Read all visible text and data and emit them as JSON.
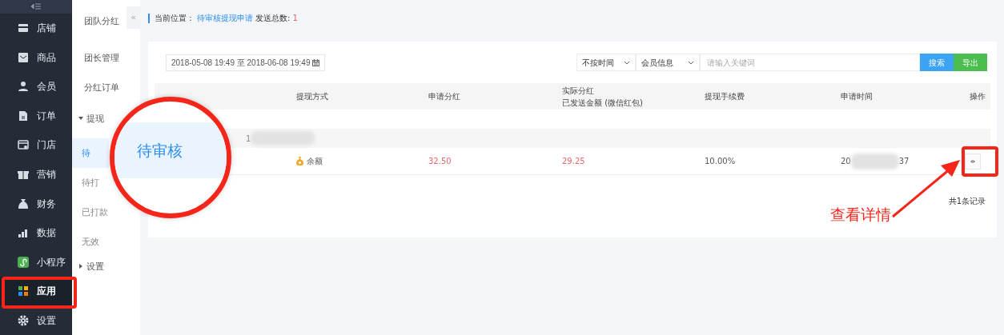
{
  "sidebar": {
    "items": [
      {
        "label": "店铺",
        "selected": false
      },
      {
        "label": "商品",
        "selected": false
      },
      {
        "label": "会员",
        "selected": false
      },
      {
        "label": "订单",
        "selected": false
      },
      {
        "label": "门店",
        "selected": false
      },
      {
        "label": "营销",
        "selected": false
      },
      {
        "label": "财务",
        "selected": false
      },
      {
        "label": "数据",
        "selected": false
      },
      {
        "label": "小程序",
        "selected": false
      },
      {
        "label": "应用",
        "selected": true
      },
      {
        "label": "设置",
        "selected": false
      }
    ]
  },
  "subnav": {
    "collapse_glyph": "«",
    "items": [
      {
        "label": "团队分红",
        "kind": "title"
      },
      {
        "label": "团长管理",
        "kind": "link"
      },
      {
        "label": "分红订单",
        "kind": "link"
      },
      {
        "label": "提现",
        "kind": "group",
        "expanded": true,
        "children": [
          {
            "label": "待",
            "selected": true
          },
          {
            "label": "待打",
            "selected": false
          },
          {
            "label": "已打款",
            "selected": false
          },
          {
            "label": "无效",
            "selected": false
          }
        ]
      },
      {
        "label": "设置",
        "kind": "group",
        "expanded": false
      }
    ]
  },
  "breadcrumb": {
    "label": "当前位置：",
    "page": "待审核提现申请",
    "count_label": "发送总数:",
    "count": "1"
  },
  "filters": {
    "date_range": "2018-05-08 19:49 至 2018-06-08 19:49",
    "selects": [
      "不按时间",
      "会员信息"
    ],
    "search": {
      "placeholder": "请输入关键词"
    },
    "buttons": [
      {
        "label": "搜索",
        "kind": "primary"
      },
      {
        "label": "导出",
        "kind": "success"
      }
    ]
  },
  "table": {
    "columns": [
      {
        "lines": [
          "提现方式"
        ]
      },
      {
        "lines": [
          "申请分红"
        ]
      },
      {
        "lines": [
          "实际分红",
          "已发送金额 (微信红包)"
        ]
      },
      {
        "lines": [
          "提现手续费"
        ]
      },
      {
        "lines": [
          "申请时间"
        ]
      },
      {
        "lines": [
          "操作"
        ]
      }
    ],
    "group_label": "1",
    "rows": [
      {
        "method": "余额",
        "applied": "32.50",
        "actual": "29.25",
        "fee": "10.00%",
        "time_parts": [
          "20",
          "37"
        ]
      }
    ]
  },
  "footer": "共1条记录",
  "annotations": {
    "magnifier_text": "待审核",
    "callout": "查看详情"
  }
}
